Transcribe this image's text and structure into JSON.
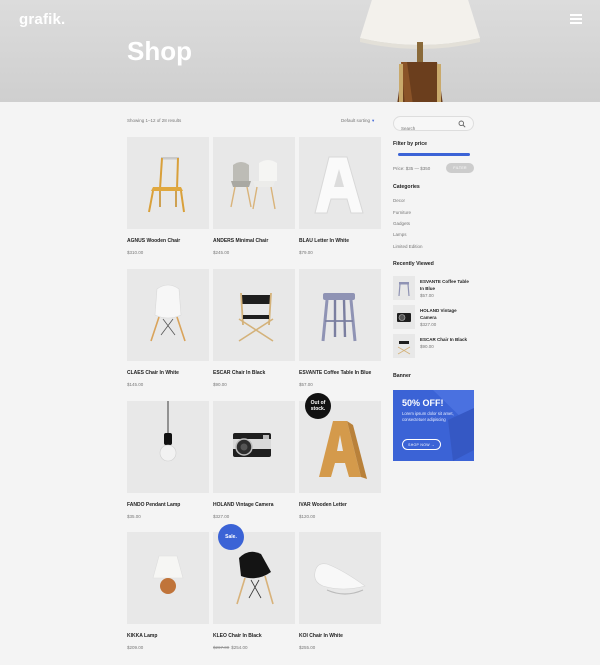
{
  "header": {
    "logo": "grafik.",
    "title": "Shop"
  },
  "toolbar": {
    "results": "Showing 1–12 of 28 results",
    "sorting": "Default sorting",
    "sorting_caret": "▾"
  },
  "products": [
    {
      "name": "AGNUS Wooden Chair",
      "price": "$310.00"
    },
    {
      "name": "ANDERS Minimal Chair",
      "price": "$245.00"
    },
    {
      "name": "BLAU Letter In White",
      "price": "$79.00"
    },
    {
      "name": "CLAES Chair In White",
      "price": "$145.00"
    },
    {
      "name": "ESCAR Chair In Black",
      "price": "$90.00"
    },
    {
      "name": "ESVANTE Coffee Table In Blue",
      "price": "$57.00"
    },
    {
      "name": "FANDO Pendant Lamp",
      "price": "$35.00"
    },
    {
      "name": "HOLAND Vintage Camera",
      "price": "$327.00"
    },
    {
      "name": "IVAR Wooden Letter",
      "price": "$120.00",
      "badge": "Out of stock."
    },
    {
      "name": "KIKKA Lamp",
      "price": "$209.00"
    },
    {
      "name": "KLEO Chair In Black",
      "old_price": "$267.00",
      "price": "$254.00",
      "badge": "Sale."
    },
    {
      "name": "KOI Chair In White",
      "price": "$255.00"
    }
  ],
  "sidebar": {
    "search_placeholder": "Search",
    "filter_title": "Filter by price",
    "price_range": "Price: $35 — $350",
    "filter_button": "FILTER",
    "categories_title": "Categories",
    "categories": [
      "Decor",
      "Furniture",
      "Gadgets",
      "Lamps",
      "Limited Edition"
    ],
    "recently_viewed_title": "Recently Viewed",
    "recently_viewed": [
      {
        "name": "ESVANTE Coffee Table In Blue",
        "price": "$57.00"
      },
      {
        "name": "HOLAND Vintage Camera",
        "price": "$327.00"
      },
      {
        "name": "ESCAR Chair In Black",
        "price": "$90.00"
      }
    ],
    "banner_title": "Banner",
    "banner": {
      "headline": "50% OFF!",
      "text": "Lorem ipsum dolor sit amet, consectetuer adipiscing",
      "button": "SHOP NOW →"
    }
  },
  "colors": {
    "accent": "#3b63d6",
    "background": "#f4f4f4",
    "tile": "#e8e8e8"
  }
}
